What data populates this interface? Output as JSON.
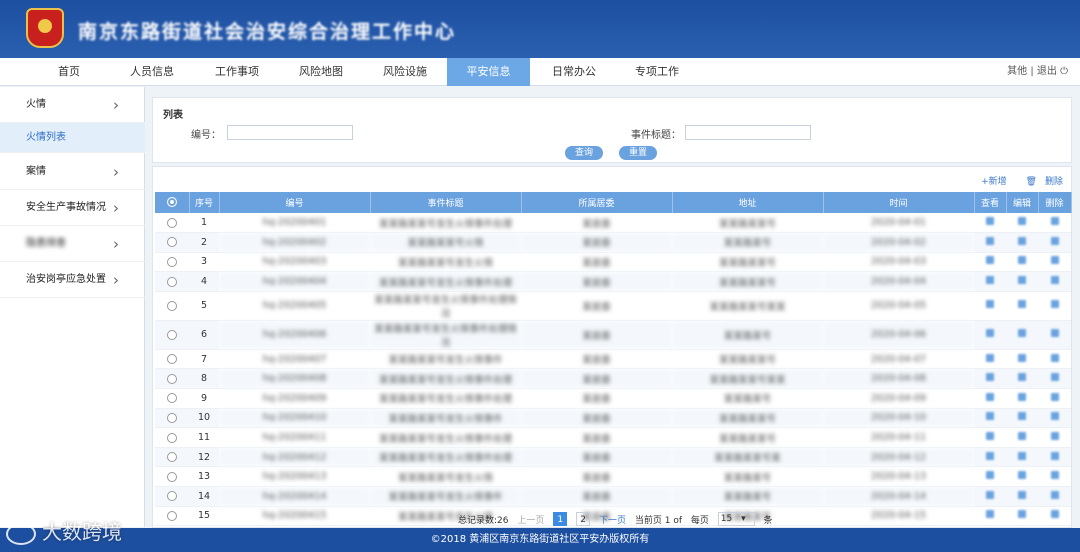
{
  "header": {
    "title": "南京东路街道社会治安综合治理工作中心"
  },
  "nav": {
    "items": [
      "首页",
      "人员信息",
      "工作事项",
      "风险地图",
      "风险设施",
      "平安信息",
      "日常办公",
      "专项工作"
    ],
    "active_index": 5,
    "right": "其他 | 退出"
  },
  "sidebar": {
    "items": [
      "火情",
      "火情列表",
      "案情",
      "安全生产事故情况",
      "隐患排查",
      "治安岗亭应急处置"
    ]
  },
  "filter": {
    "title": "列表",
    "label_no": "编号：",
    "label_event_title": "事件标题：",
    "search_label": "查询",
    "reset_label": "重置"
  },
  "toolbar": {
    "add": "+新增",
    "delete": "删除"
  },
  "table": {
    "columns": [
      "序号",
      "编号",
      "事件标题",
      "所属居委",
      "地址",
      "时间",
      "查看",
      "编辑",
      "删除"
    ],
    "rows": [
      [
        "1",
        "hq-20200401",
        "某某路某某号发生火情事件处理",
        "某居委",
        "某某路某某号",
        "2020-04-01"
      ],
      [
        "2",
        "hq-20200402",
        "某某路某某号火情",
        "某居委",
        "某某路某号",
        "2020-04-02"
      ],
      [
        "3",
        "hq-20200403",
        "某某路某某号发生火情",
        "某居委",
        "某某路某某号",
        "2020-04-03"
      ],
      [
        "4",
        "hq-20200404",
        "某某路某某号发生火情事件处理",
        "某居委",
        "某某路某某号",
        "2020-04-04"
      ],
      [
        "5",
        "hq-20200405",
        "某某路某某号发生火情事件处理情况",
        "某居委",
        "某某路某某号某某",
        "2020-04-05"
      ],
      [
        "6",
        "hq-20200406",
        "某某路某某号发生火情事件处理情况",
        "某居委",
        "某某路某号",
        "2020-04-06"
      ],
      [
        "7",
        "hq-20200407",
        "某某路某某号发生火情事件",
        "某居委",
        "某某路某某号",
        "2020-04-07"
      ],
      [
        "8",
        "hq-20200408",
        "某某路某某号发生火情事件处理",
        "某居委",
        "某某路某某号某某",
        "2020-04-08"
      ],
      [
        "9",
        "hq-20200409",
        "某某路某某号发生火情事件处理",
        "某居委",
        "某某路某号",
        "2020-04-09"
      ],
      [
        "10",
        "hq-20200410",
        "某某路某某号发生火情事件",
        "某居委",
        "某某路某某号",
        "2020-04-10"
      ],
      [
        "11",
        "hq-20200411",
        "某某路某某号发生火情事件处理",
        "某居委",
        "某某路某某号",
        "2020-04-11"
      ],
      [
        "12",
        "hq-20200412",
        "某某路某某号发生火情事件处理",
        "某居委",
        "某某路某某号某",
        "2020-04-12"
      ],
      [
        "13",
        "hq-20200413",
        "某某路某某号发生火情",
        "某居委",
        "某某路某号",
        "2020-04-13"
      ],
      [
        "14",
        "hq-20200414",
        "某某路某某号发生火情事件",
        "某居委",
        "某某路某号",
        "2020-04-14"
      ],
      [
        "15",
        "hq-20200415",
        "某某路某某号发生火情",
        "某居委",
        "某某路某号",
        "2020-04-15"
      ]
    ]
  },
  "pager": {
    "total": "总记录数:26",
    "prev": "上一页",
    "pages": [
      "1",
      "2"
    ],
    "current": "1",
    "next": "下一页",
    "current_of": "当前页 1 of",
    "page_size_label": "每页",
    "page_size": "15",
    "unit": "条"
  },
  "footer": {
    "text": "©2018 黄浦区南京东路街道社区平安办版权所有"
  },
  "watermark": {
    "text": "大数跨境"
  },
  "colors": {
    "header": "#1d4fa0",
    "accent": "#6aa2e0",
    "active_nav": "#6da8e6"
  }
}
